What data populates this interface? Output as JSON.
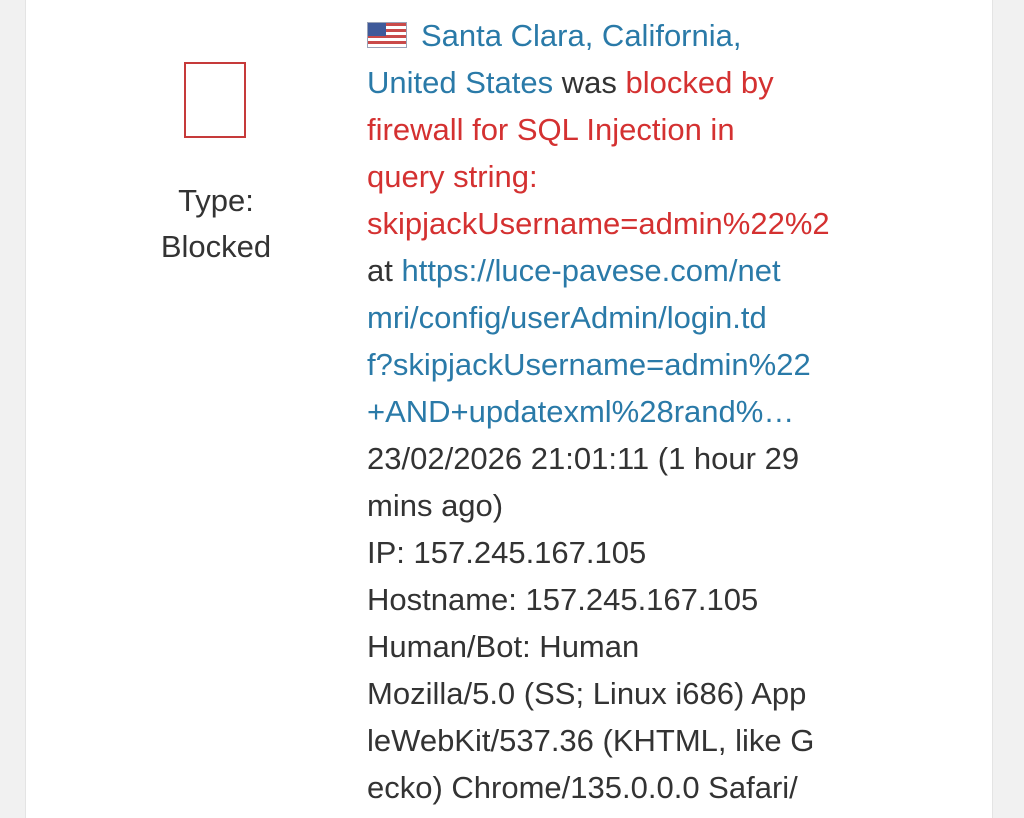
{
  "entry": {
    "type_label": "Type:",
    "type_value": "Blocked",
    "flag_icon": "us-flag-icon",
    "location_line1": "Santa Clara, California,",
    "location_line2_link": "United States",
    "location_line2_text": " was ",
    "blocked_line2": "blocked by",
    "blocked_line3": "firewall for SQL Injection in",
    "blocked_line4": "query string:",
    "blocked_line5": "skipjackUsername=admin%22%2",
    "at_text": "at ",
    "url_line1": "https://luce-pavese.com/net",
    "url_line2": "mri/config/userAdmin/login.td",
    "url_line3": "f?skipjackUsername=admin%22",
    "url_line4": "+AND+updatexml%28rand%…",
    "time_line1": "23/02/2026 21:01:11 (1 hour 29",
    "time_line2": "mins ago)",
    "ip": "IP: 157.245.167.105",
    "hostname": "Hostname: 157.245.167.105",
    "human_bot": "Human/Bot: Human",
    "ua_line1": "Mozilla/5.0 (SS; Linux i686) App",
    "ua_line2": "leWebKit/537.36 (KHTML, like G",
    "ua_line3": "ecko) Chrome/135.0.0.0 Safari/"
  },
  "colors": {
    "link": "#2a7aa8",
    "blocked": "#d43131",
    "text": "#333333"
  }
}
